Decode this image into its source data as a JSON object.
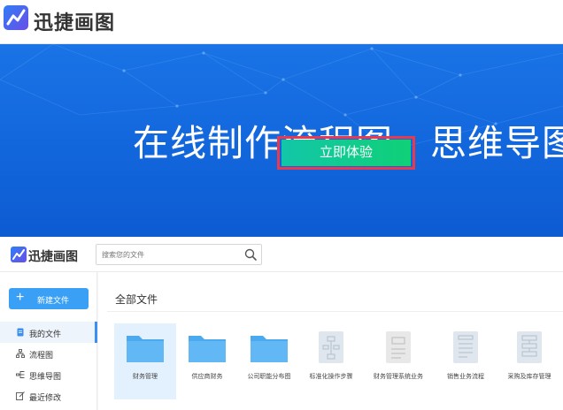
{
  "brand": {
    "name": "迅捷画图",
    "accent": "#2f7ef5"
  },
  "hero": {
    "title": "在线制作流程图、思维导图",
    "cta_label": "立即体验",
    "bg_color": "#1266dc",
    "cta_color": "#10d077",
    "highlight_color": "#e83a4f"
  },
  "app": {
    "logo_text": "迅捷画图",
    "search": {
      "placeholder": "搜索您的文件",
      "icon": "search-icon"
    },
    "sidebar": {
      "new_button_label": "新建文件",
      "items": [
        {
          "label": "我的文件",
          "icon": "file-icon",
          "active": true
        },
        {
          "label": "流程图",
          "icon": "flowchart-icon",
          "active": false
        },
        {
          "label": "思维导图",
          "icon": "mindmap-icon",
          "active": false
        },
        {
          "label": "最近修改",
          "icon": "edit-icon",
          "active": false
        }
      ]
    },
    "main": {
      "section_title": "全部文件",
      "files": [
        {
          "name": "财务管理",
          "type": "folder",
          "selected": true
        },
        {
          "name": "供应商财务",
          "type": "folder",
          "selected": false
        },
        {
          "name": "公司职能分布图",
          "type": "folder",
          "selected": false
        },
        {
          "name": "标准化操作步骤",
          "type": "document",
          "selected": false
        },
        {
          "name": "财务管理系统业务",
          "type": "document",
          "selected": false
        },
        {
          "name": "销售业务流程",
          "type": "document",
          "selected": false
        },
        {
          "name": "采购及库存管理",
          "type": "document",
          "selected": false
        }
      ]
    }
  }
}
